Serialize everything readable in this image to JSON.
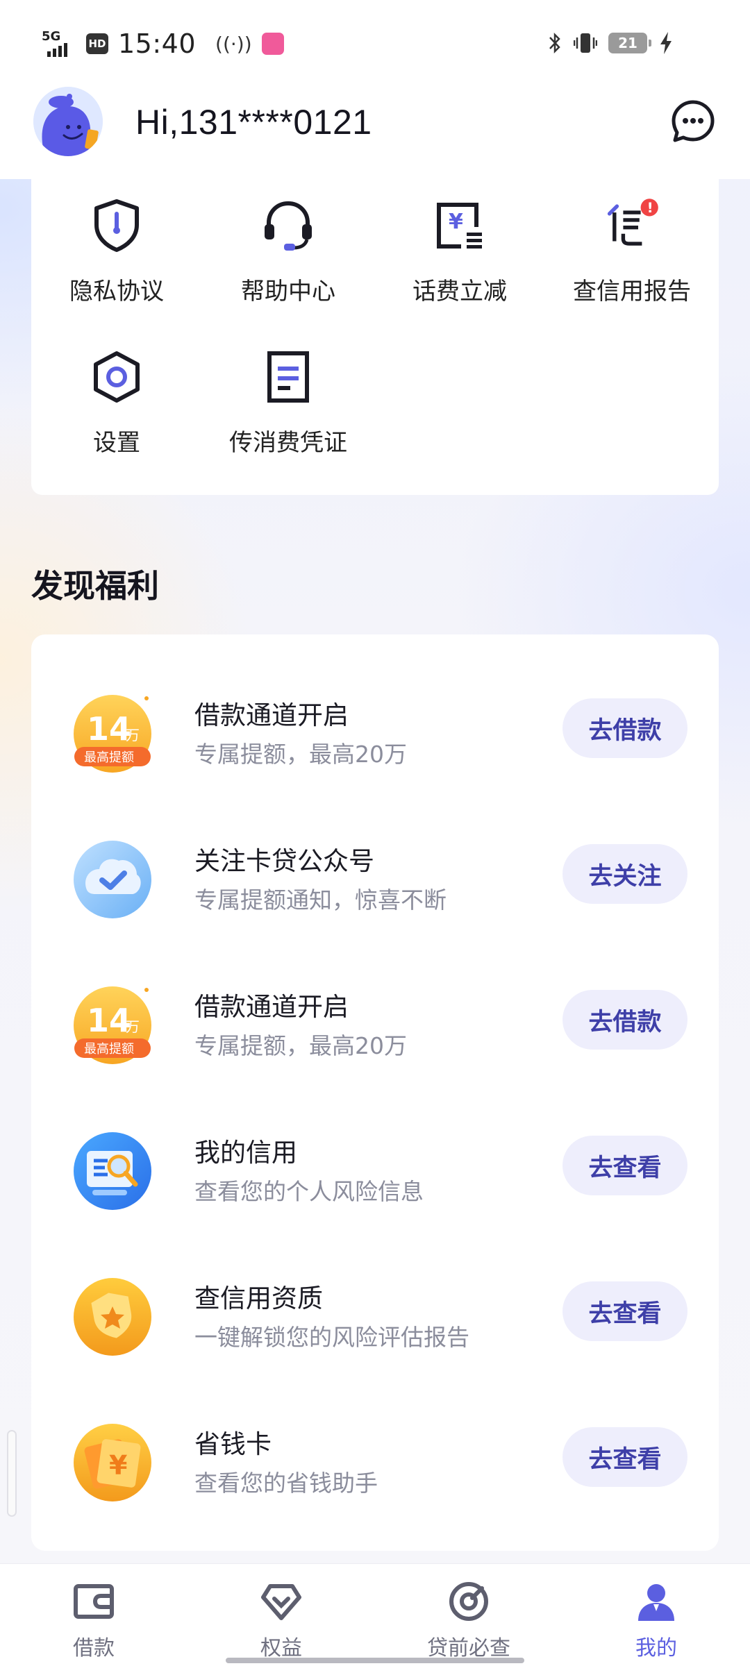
{
  "status_bar": {
    "network": "5G",
    "hd": "HD",
    "time": "15:40",
    "nfc": "((·))",
    "battery": "21"
  },
  "header": {
    "greeting": "Hi,131****0121"
  },
  "services": [
    {
      "label": "隐私协议",
      "icon": "shield-icon"
    },
    {
      "label": "帮助中心",
      "icon": "headset-icon"
    },
    {
      "label": "话费立减",
      "icon": "yuan-receipt-icon"
    },
    {
      "label": "查信用报告",
      "icon": "credit-report-icon",
      "badge": "!"
    },
    {
      "label": "设置",
      "icon": "settings-hexagon-icon"
    },
    {
      "label": "传消费凭证",
      "icon": "document-icon"
    }
  ],
  "section_title": "发现福利",
  "welfare": [
    {
      "title": "借款通道开启",
      "subtitle": "专属提额，最高20万",
      "button": "去借款",
      "icon": "loan-14w-icon",
      "badge_amount": "14",
      "badge_unit": "万",
      "badge_text": "最高提额"
    },
    {
      "title": "关注卡贷公众号",
      "subtitle": "专属提额通知，惊喜不断",
      "button": "去关注",
      "icon": "follow-check-cloud-icon"
    },
    {
      "title": "借款通道开启",
      "subtitle": "专属提额，最高20万",
      "button": "去借款",
      "icon": "loan-14w-icon",
      "badge_amount": "14",
      "badge_unit": "万",
      "badge_text": "最高提额"
    },
    {
      "title": "我的信用",
      "subtitle": "查看您的个人风险信息",
      "button": "去查看",
      "icon": "credit-magnifier-icon"
    },
    {
      "title": "查信用资质",
      "subtitle": "一键解锁您的风险评估报告",
      "button": "去查看",
      "icon": "star-shield-icon"
    },
    {
      "title": "省钱卡",
      "subtitle": "查看您的省钱助手",
      "button": "去查看",
      "icon": "yuan-card-icon"
    }
  ],
  "bottom_nav": [
    {
      "label": "借款",
      "icon": "wallet-icon",
      "active": false
    },
    {
      "label": "权益",
      "icon": "heart-gem-icon",
      "active": false
    },
    {
      "label": "贷前必查",
      "icon": "target-icon",
      "active": false
    },
    {
      "label": "我的",
      "icon": "person-icon",
      "active": true
    }
  ],
  "colors": {
    "accent": "#5b5fe0",
    "button_bg": "#eeeefc",
    "button_text": "#3e3fa8",
    "badge_red": "#f04444",
    "gold": "#f7a623"
  }
}
